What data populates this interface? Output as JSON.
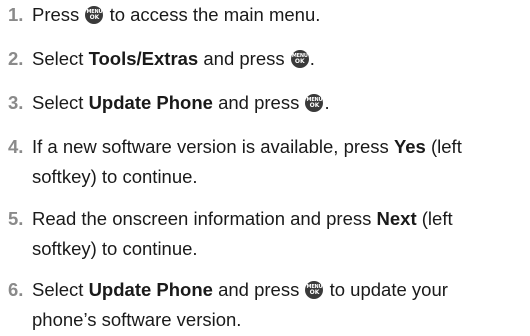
{
  "menu_key": {
    "top": "MENU",
    "bottom": "OK"
  },
  "steps": [
    {
      "num": "1.",
      "pre": "Press ",
      "post": " to access the main menu."
    },
    {
      "num": "2.",
      "pre": "Select ",
      "bold": "Tools/Extras",
      "mid": " and press ",
      "post": "."
    },
    {
      "num": "3.",
      "pre": "Select ",
      "bold": "Update Phone",
      "mid": " and press ",
      "post": "."
    },
    {
      "num": "4.",
      "line1_pre": "If a new software version is available, press ",
      "bold": "Yes",
      "line1_post": " (left",
      "line2": "softkey) to continue."
    },
    {
      "num": "5.",
      "line1_pre": "Read the onscreen information and press ",
      "bold": "Next",
      "line1_post": " (left",
      "line2": "softkey) to continue."
    },
    {
      "num": "6.",
      "pre": "Select ",
      "bold": "Update Phone",
      "mid": " and press ",
      "post": " to update your",
      "line2": "phone’s software version."
    }
  ]
}
